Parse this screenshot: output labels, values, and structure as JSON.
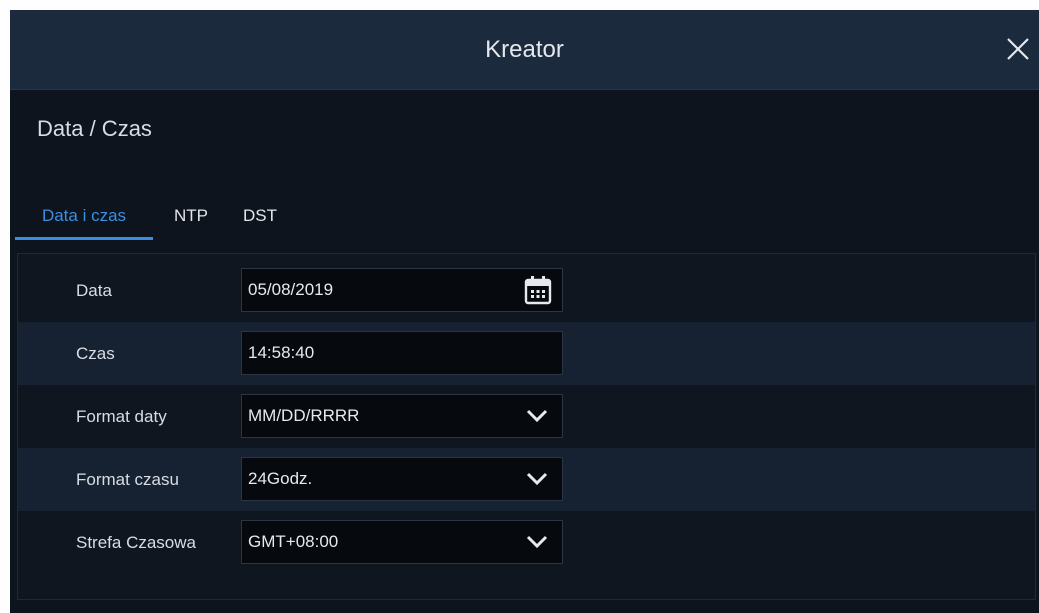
{
  "window": {
    "title": "Kreator"
  },
  "section": {
    "title": "Data / Czas"
  },
  "tabs": [
    {
      "label": "Data i czas",
      "active": true
    },
    {
      "label": "NTP",
      "active": false
    },
    {
      "label": "DST",
      "active": false
    }
  ],
  "form": {
    "date": {
      "label": "Data",
      "value": "05/08/2019"
    },
    "time": {
      "label": "Czas",
      "value": "14:58:40"
    },
    "date_format": {
      "label": "Format daty",
      "value": "MM/DD/RRRR"
    },
    "time_format": {
      "label": "Format czasu",
      "value": "24Godz."
    },
    "timezone": {
      "label": "Strefa Czasowa",
      "value": "GMT+08:00"
    }
  },
  "icons": {
    "close": "close-icon",
    "calendar": "calendar-icon",
    "dropdown": "chevron-down-icon"
  },
  "colors": {
    "accent": "#3c8ee0",
    "titlebar": "#1b2a3d",
    "background": "#0e141d"
  }
}
